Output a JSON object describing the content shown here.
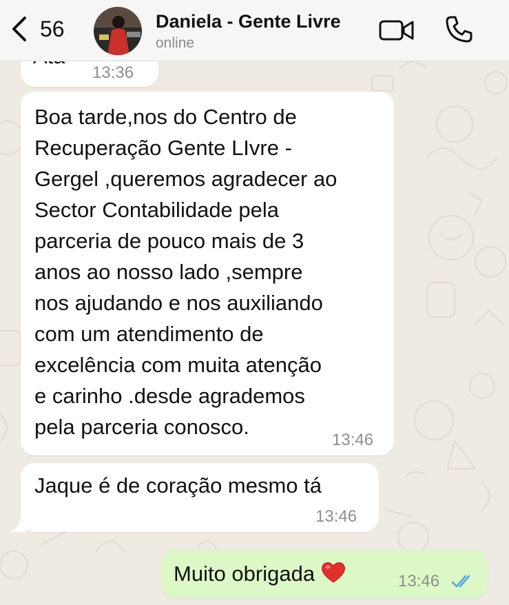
{
  "header": {
    "back_count": "56",
    "contact_name": "Daniela - Gente Livre",
    "status": "online"
  },
  "messages": [
    {
      "direction": "incoming",
      "text": "Ata",
      "time": "13:36"
    },
    {
      "direction": "incoming",
      "text": "Boa tarde,nos do Centro de\nRecuperação Gente LIvre -\nGergel ,queremos agradecer ao\nSector Contabilidade pela\nparceria de pouco mais de 3\nanos ao nosso lado ,sempre\nnos ajudando e nos auxiliando\ncom um atendimento de\nexcelência com muita atenção\ne carinho .desde agrademos\npela parceria conosco.",
      "time": "13:46"
    },
    {
      "direction": "incoming",
      "text": "Jaque é de coração mesmo tá",
      "time": "13:46"
    },
    {
      "direction": "outgoing",
      "text": "Muito obrigada",
      "time": "13:46",
      "emoji": "heart"
    }
  ],
  "colors": {
    "background": "#efeae2",
    "incoming_bubble": "#ffffff",
    "outgoing_bubble": "#dcf8c6",
    "read_check": "#4fa3e0"
  },
  "icons": [
    "back-chevron-icon",
    "video-call-icon",
    "phone-call-icon",
    "double-check-icon",
    "red-heart-emoji"
  ]
}
